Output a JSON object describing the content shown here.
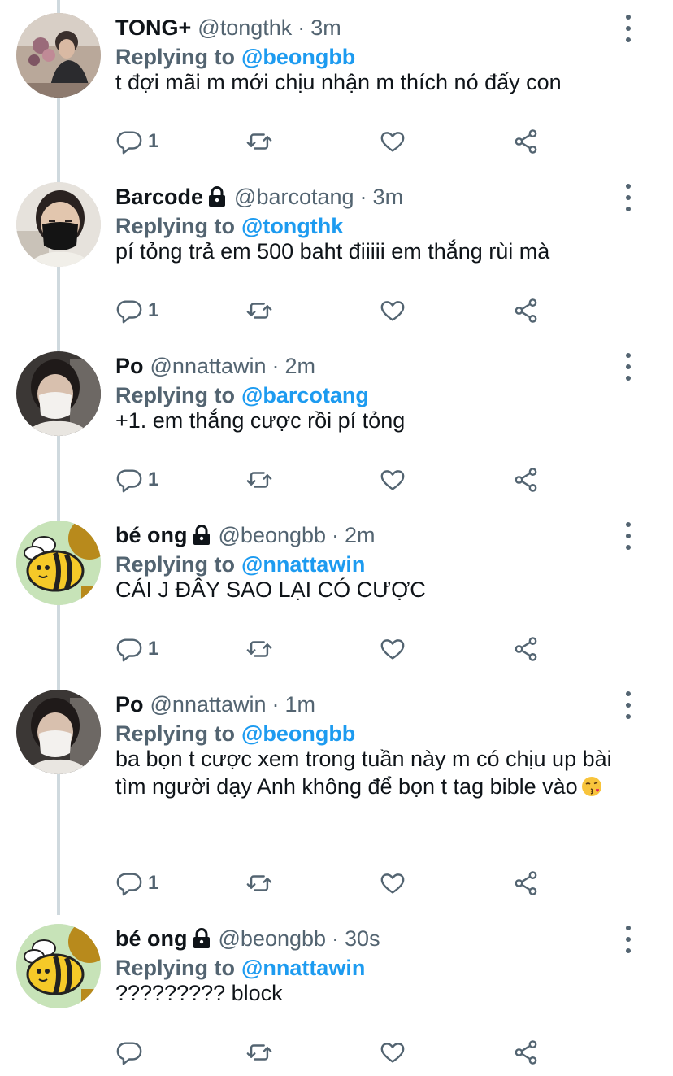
{
  "colors": {
    "link": "#1d9bf0",
    "muted": "#536471",
    "text": "#0f1419",
    "thread_line": "#cfd9de"
  },
  "replying_label": "Replying to",
  "tweets": [
    {
      "name": "TONG+",
      "locked": false,
      "handle": "@tongthk",
      "time": "3m",
      "reply_to": "@beongbb",
      "text": "t đợi mãi m mới chịu nhận m thích nó đấy con",
      "emoji": "",
      "reply_count": "1",
      "avatar": "photo-man-flowers"
    },
    {
      "name": "Barcode",
      "locked": true,
      "handle": "@barcotang",
      "time": "3m",
      "reply_to": "@tongthk",
      "text": "pí tỏng trả em 500 baht điiiii em thắng rùi mà",
      "emoji": "",
      "reply_count": "1",
      "avatar": "photo-man-mask"
    },
    {
      "name": "Po",
      "locked": false,
      "handle": "@nnattawin",
      "time": "2m",
      "reply_to": "@barcotang",
      "text": "+1. em thắng cược rồi pí tỏng",
      "emoji": "",
      "reply_count": "1",
      "avatar": "photo-man-white-mask"
    },
    {
      "name": "bé ong",
      "locked": true,
      "handle": "@beongbb",
      "time": "2m",
      "reply_to": "@nnattawin",
      "text": "CÁI J ĐÂY SAO LẠI CÓ CƯỢC",
      "emoji": "",
      "reply_count": "1",
      "avatar": "cartoon-bee"
    },
    {
      "name": "Po",
      "locked": false,
      "handle": "@nnattawin",
      "time": "1m",
      "reply_to": "@beongbb",
      "text": "ba bọn t cược xem trong tuần này m có chịu up bài tìm người dạy Anh không để bọn t tag bible vào",
      "emoji": "kissing-face-emoji",
      "reply_count": "1",
      "avatar": "photo-man-white-mask"
    },
    {
      "name": "bé ong",
      "locked": true,
      "handle": "@beongbb",
      "time": "30s",
      "reply_to": "@nnattawin",
      "text": "????????? block",
      "emoji": "",
      "reply_count": "",
      "avatar": "cartoon-bee"
    }
  ],
  "icons": {
    "reply": "reply-icon",
    "retweet": "retweet-icon",
    "like": "heart-icon",
    "share": "share-icon",
    "more": "more-vertical-icon",
    "lock": "lock-icon"
  }
}
